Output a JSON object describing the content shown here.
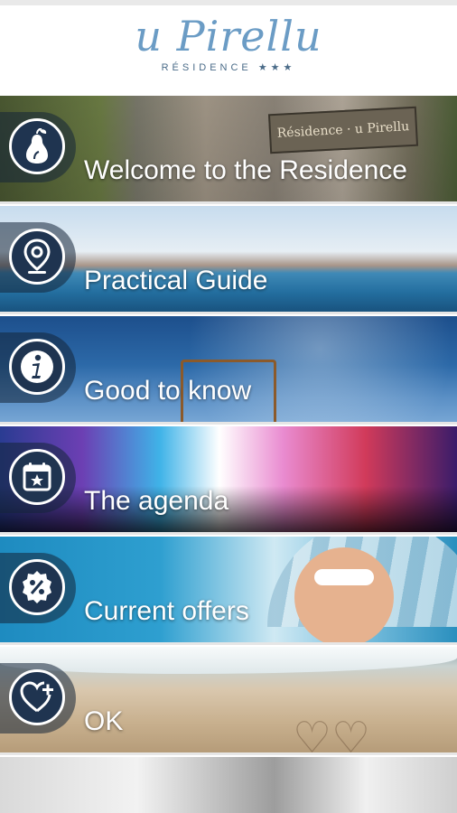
{
  "brand": {
    "title": "u Pirellu",
    "subtitle": "RÉSIDENCE ★★★"
  },
  "menu": [
    {
      "label": "Welcome to the Residence",
      "icon": "pear-icon"
    },
    {
      "label": "Practical Guide",
      "icon": "location-pin-icon"
    },
    {
      "label": "Good to know",
      "icon": "info-icon"
    },
    {
      "label": "The agenda",
      "icon": "calendar-star-icon"
    },
    {
      "label": "Current offers",
      "icon": "percent-badge-icon"
    },
    {
      "label": "OK",
      "icon": "heart-plus-icon"
    }
  ],
  "scene": {
    "sign_text": "Résidence · u Pirellu"
  }
}
